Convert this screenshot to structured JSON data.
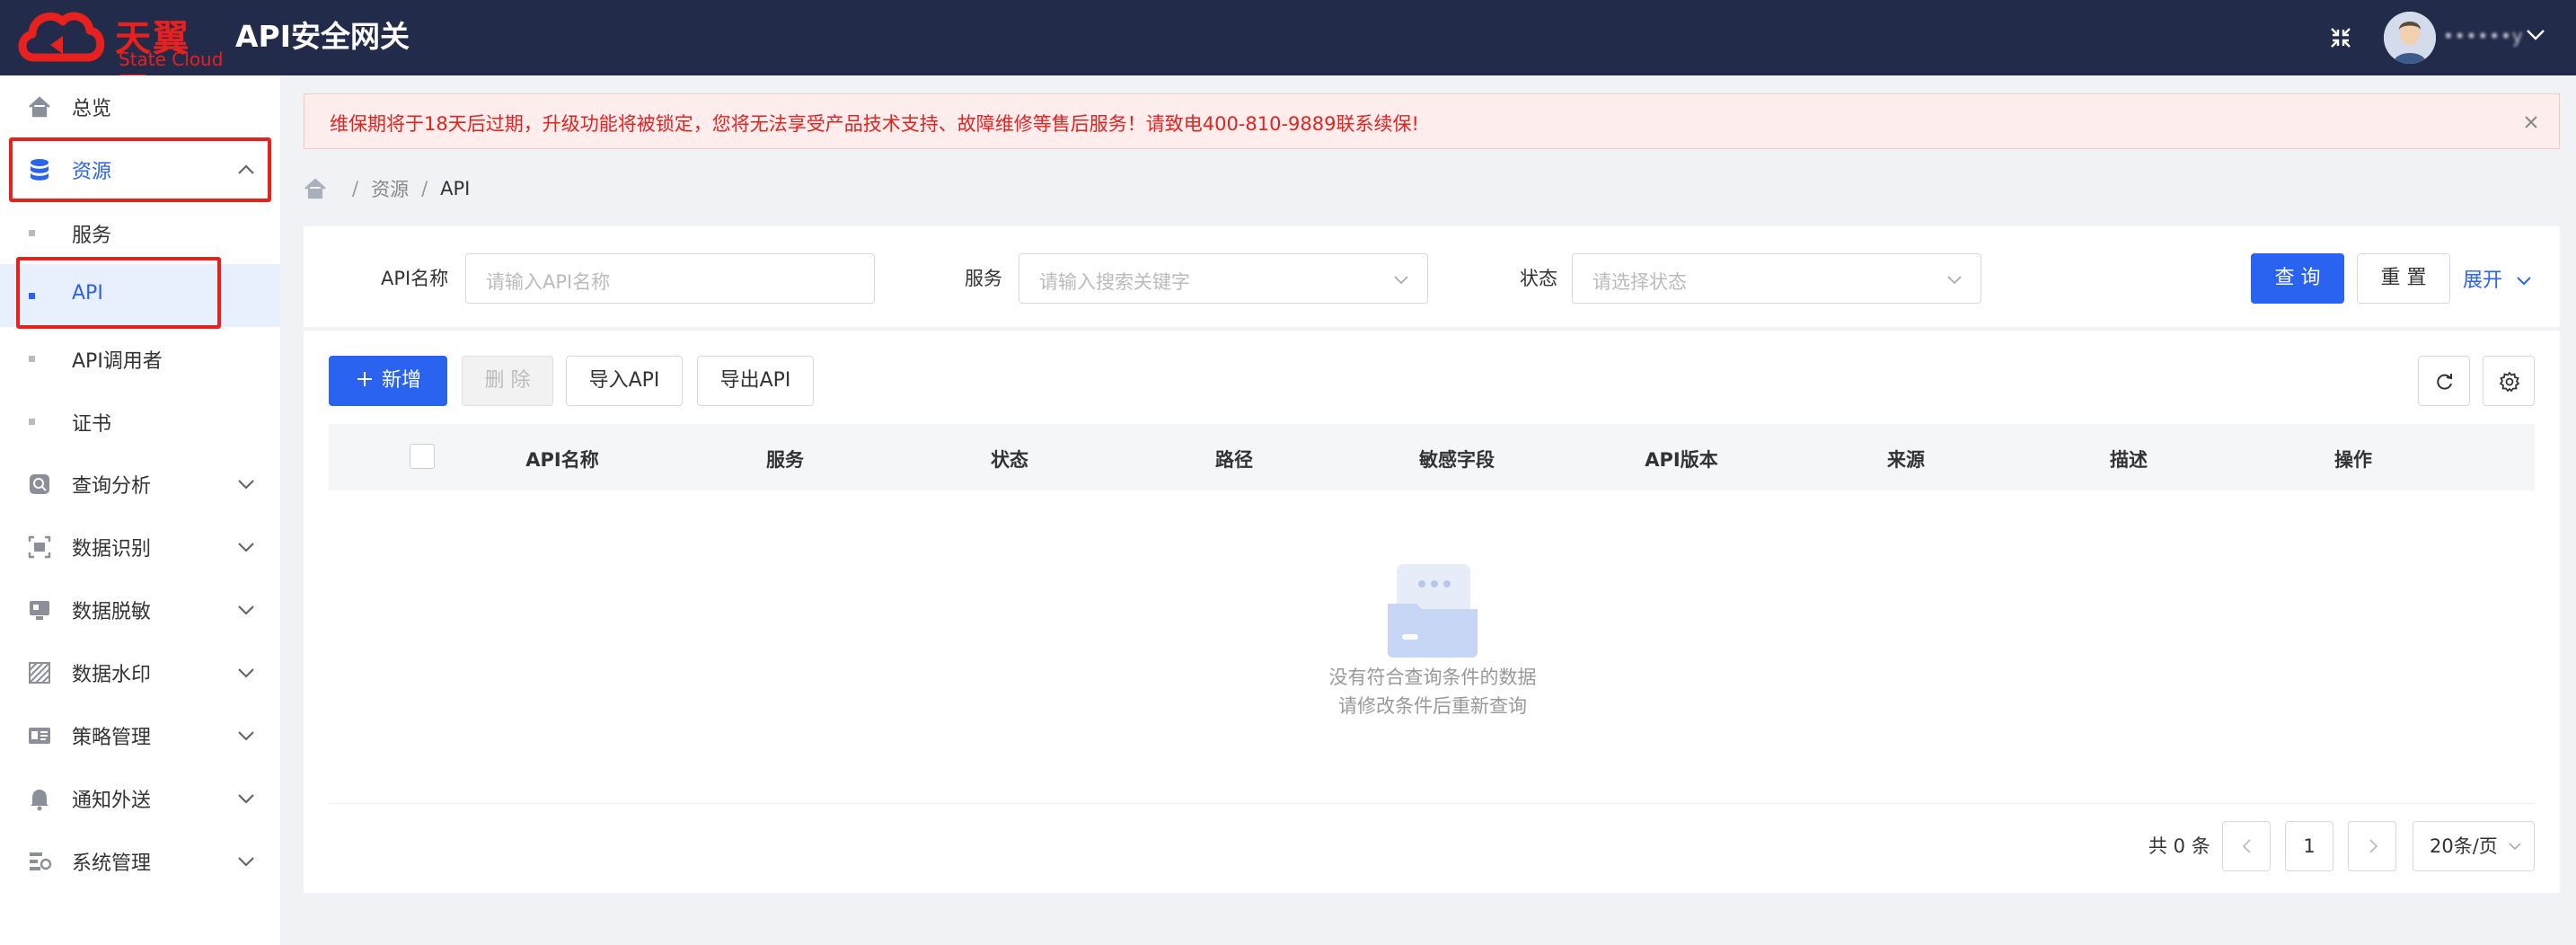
{
  "header": {
    "logo_cn": "天翼云",
    "logo_en": "State Cloud",
    "title": "API安全网关",
    "username": "••••••y",
    "icons": [
      "fullscreen-exit-icon",
      "avatar",
      "chevron-down-icon"
    ]
  },
  "sidebar": {
    "items": [
      {
        "label": "总览",
        "icon": "home-icon"
      },
      {
        "label": "资源",
        "icon": "database-icon",
        "expanded": true
      },
      {
        "label": "服务"
      },
      {
        "label": "API",
        "active": true
      },
      {
        "label": "API调用者"
      },
      {
        "label": "证书"
      },
      {
        "label": "查询分析",
        "icon": "search-analysis-icon"
      },
      {
        "label": "数据识别",
        "icon": "data-identify-icon"
      },
      {
        "label": "数据脱敏",
        "icon": "data-mask-icon"
      },
      {
        "label": "数据水印",
        "icon": "watermark-icon"
      },
      {
        "label": "策略管理",
        "icon": "policy-icon"
      },
      {
        "label": "通知外送",
        "icon": "bell-icon"
      },
      {
        "label": "系统管理",
        "icon": "system-icon"
      }
    ]
  },
  "alert": {
    "text": "维保期将于18天后过期，升级功能将被锁定，您将无法享受产品技术支持、故障维修等售后服务！请致电400-810-9889联系续保!"
  },
  "breadcrumb": {
    "items": [
      "资源",
      "API"
    ]
  },
  "filters": {
    "api_name_label": "API名称",
    "api_name_placeholder": "请输入API名称",
    "service_label": "服务",
    "service_placeholder": "请输入搜索关键字",
    "status_label": "状态",
    "status_placeholder": "请选择状态",
    "query_label": "查 询",
    "reset_label": "重 置",
    "expand_label": "展开"
  },
  "toolbar": {
    "add_label": "新增",
    "delete_label": "删 除",
    "import_label": "导入API",
    "export_label": "导出API"
  },
  "table": {
    "columns": [
      "API名称",
      "服务",
      "状态",
      "路径",
      "敏感字段",
      "API版本",
      "来源",
      "描述",
      "操作"
    ],
    "rows": [],
    "empty_line1": "没有符合查询条件的数据",
    "empty_line2": "请修改条件后重新查询"
  },
  "pagination": {
    "total_text": "共 0 条",
    "current_page": "1",
    "page_size": "20条/页"
  },
  "colors": {
    "header_bg": "#232b4a",
    "primary": "#2a63f0",
    "brand_red": "#e8211f",
    "alert_bg": "#fdeeed"
  }
}
